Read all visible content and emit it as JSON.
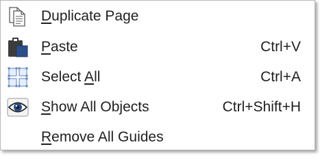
{
  "menu": {
    "items": [
      {
        "icon": "duplicate-page-icon",
        "label_before": "",
        "mnemonic": "D",
        "label_after": "uplicate Page",
        "shortcut": ""
      },
      {
        "icon": "paste-icon",
        "label_before": "",
        "mnemonic": "P",
        "label_after": "aste",
        "shortcut": "Ctrl+V"
      },
      {
        "icon": "select-all-icon",
        "label_before": "Select ",
        "mnemonic": "A",
        "label_after": "ll",
        "shortcut": "Ctrl+A"
      },
      {
        "icon": "eye-icon",
        "label_before": "",
        "mnemonic": "S",
        "label_after": "how All Objects",
        "shortcut": "Ctrl+Shift+H"
      },
      {
        "icon": "",
        "label_before": "",
        "mnemonic": "R",
        "label_after": "emove All Guides",
        "shortcut": ""
      }
    ]
  },
  "colors": {
    "text": "#1f1f1f",
    "border": "#b8b8b8",
    "icon_blue": "#2b4f8a",
    "icon_dark": "#3a3a3a"
  }
}
